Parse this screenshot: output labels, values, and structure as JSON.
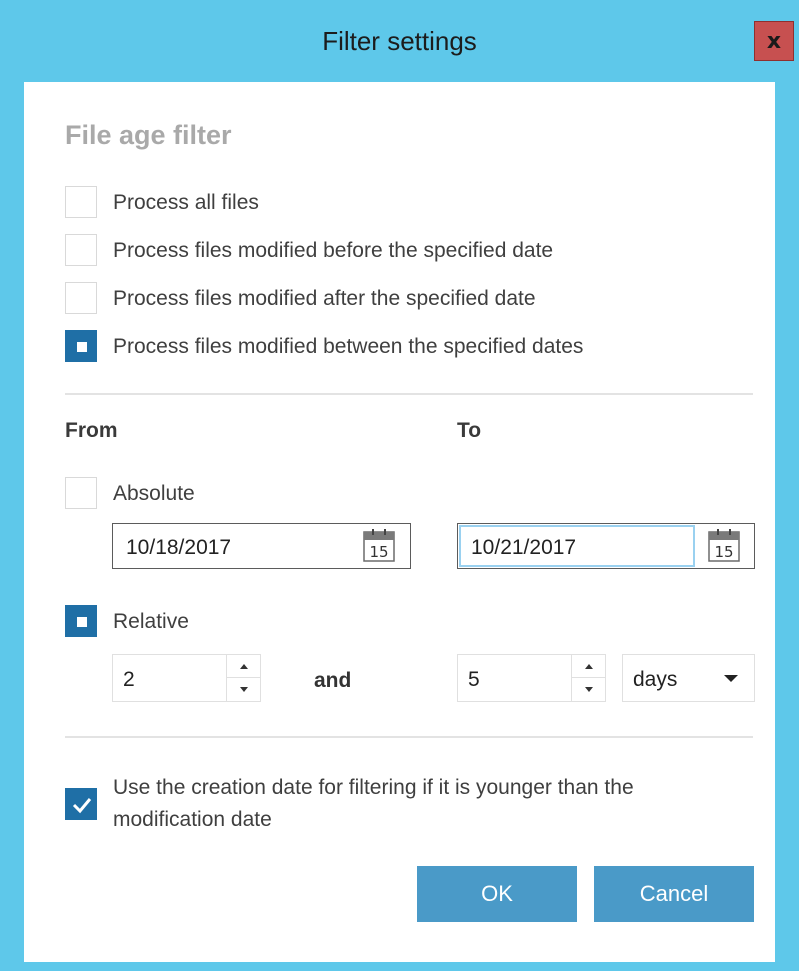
{
  "window": {
    "title": "Filter settings",
    "close_label": "x"
  },
  "section": {
    "title": "File age filter"
  },
  "options": [
    {
      "label": "Process all files",
      "selected": false
    },
    {
      "label": "Process files modified before the specified date",
      "selected": false
    },
    {
      "label": "Process files modified after the specified date",
      "selected": false
    },
    {
      "label": "Process files modified between the specified dates",
      "selected": true
    }
  ],
  "range": {
    "from_label": "From",
    "to_label": "To",
    "absolute": {
      "label": "Absolute",
      "checked": false,
      "from_date": "10/18/2017",
      "to_date": "10/21/2017",
      "calendar_day": "15"
    },
    "relative": {
      "label": "Relative",
      "checked": true,
      "from_value": "2",
      "and_label": "and",
      "to_value": "5",
      "unit": "days"
    }
  },
  "creation_date": {
    "label_line1": "Use the creation date for filtering if it is younger than the",
    "label_line2": "modification date",
    "checked": true
  },
  "buttons": {
    "ok": "OK",
    "cancel": "Cancel"
  },
  "colors": {
    "title_bar": "#5ec8ea",
    "accent": "#1f6fa6",
    "button": "#4a9ac8",
    "close": "#c75050"
  }
}
